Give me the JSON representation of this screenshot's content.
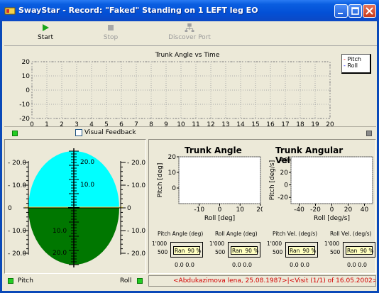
{
  "window": {
    "title": "SwayStar - Record: \"Faked\" Standing on 1 LEFT leg EO"
  },
  "toolbar": {
    "start_label": "Start",
    "stop_label": "Stop",
    "discover_label": "Discover Port"
  },
  "trunk_chart": {
    "title": "Trunk Angle vs Time",
    "legend": [
      "Pitch",
      "Roll"
    ],
    "pitch_color": "#ff0000",
    "roll_color": "#0000ff"
  },
  "feedback": {
    "visual_feedback_label": "Visual Feedback",
    "checked": false,
    "pitch_label": "Pitch",
    "roll_label": "Roll",
    "upper_color": "#00ffff",
    "lower_color": "#007700"
  },
  "angle_panel": {
    "trunk_angle_title": "Trunk Angle",
    "trunk_velocity_title": "Trunk Angular Velocity",
    "angle_ylabel": "Pitch [deg]",
    "angle_xlabel": "Roll [deg]",
    "velocity_ylabel": "Pitch [deg/s]",
    "velocity_xlabel": "Roll [deg/s]"
  },
  "mini_gauges": [
    {
      "title": "Pitch Angle (deg)",
      "range_label": "Ran",
      "percent": "90 %",
      "axis_top": "1'000",
      "axis_bottom": "500",
      "zeros": "0.0 0.0"
    },
    {
      "title": "Roll Angle (deg)",
      "range_label": "Ran",
      "percent": "90 %",
      "axis_top": "1'000",
      "axis_bottom": "500",
      "zeros": "0.0 0.0"
    },
    {
      "title": "Pitch Vel. (deg/s)",
      "range_label": "Ran",
      "percent": "90 %",
      "axis_top": "1'000",
      "axis_bottom": "500",
      "zeros": "0.0 0.0"
    },
    {
      "title": "Roll Vel. (deg/s)",
      "range_label": "Ran",
      "percent": "90 %",
      "axis_top": "1'000",
      "axis_bottom": "500",
      "zeros": "0.0 0.0"
    }
  ],
  "status_bar": {
    "text": "<Abdukazimova lena, 25.08.1987>|<Visit (1/1) of 16.05.2002>"
  },
  "chart_data": [
    {
      "type": "line",
      "title": "Trunk Angle vs Time",
      "xlabel": "",
      "ylabel": "",
      "x_ticks": [
        0,
        1,
        2,
        3,
        4,
        5,
        6,
        7,
        8,
        9,
        10,
        11,
        12,
        13,
        14,
        15,
        16,
        17,
        18,
        19,
        20
      ],
      "y_ticks": [
        20,
        10,
        0,
        -10,
        -20
      ],
      "xlim": [
        0,
        20
      ],
      "ylim": [
        -20,
        20
      ],
      "grid": true,
      "legend": "top-right",
      "series": [
        {
          "name": "Pitch",
          "values": []
        },
        {
          "name": "Roll",
          "values": []
        }
      ]
    },
    {
      "type": "scatter",
      "title": "Trunk Angle",
      "xlabel": "Roll [deg]",
      "ylabel": "Pitch [deg]",
      "x_ticks": [
        -10,
        0,
        10,
        20
      ],
      "y_ticks": [
        20,
        10,
        0
      ],
      "series": []
    },
    {
      "type": "scatter",
      "title": "Trunk Angular Velocity",
      "xlabel": "Roll [deg/s]",
      "ylabel": "Pitch [deg/s]",
      "x_ticks": [
        -40,
        -20,
        0,
        20,
        40
      ],
      "y_ticks": [
        40,
        20,
        0,
        -20
      ],
      "series": []
    }
  ],
  "feedback_scale": {
    "left_ticks": [
      "20.0",
      "10.0",
      "0",
      "10.0",
      "20.0"
    ],
    "inner_ticks_top": [
      "20.0",
      "10.0"
    ],
    "inner_ticks_bottom": [
      "10.0",
      "20.0"
    ]
  }
}
